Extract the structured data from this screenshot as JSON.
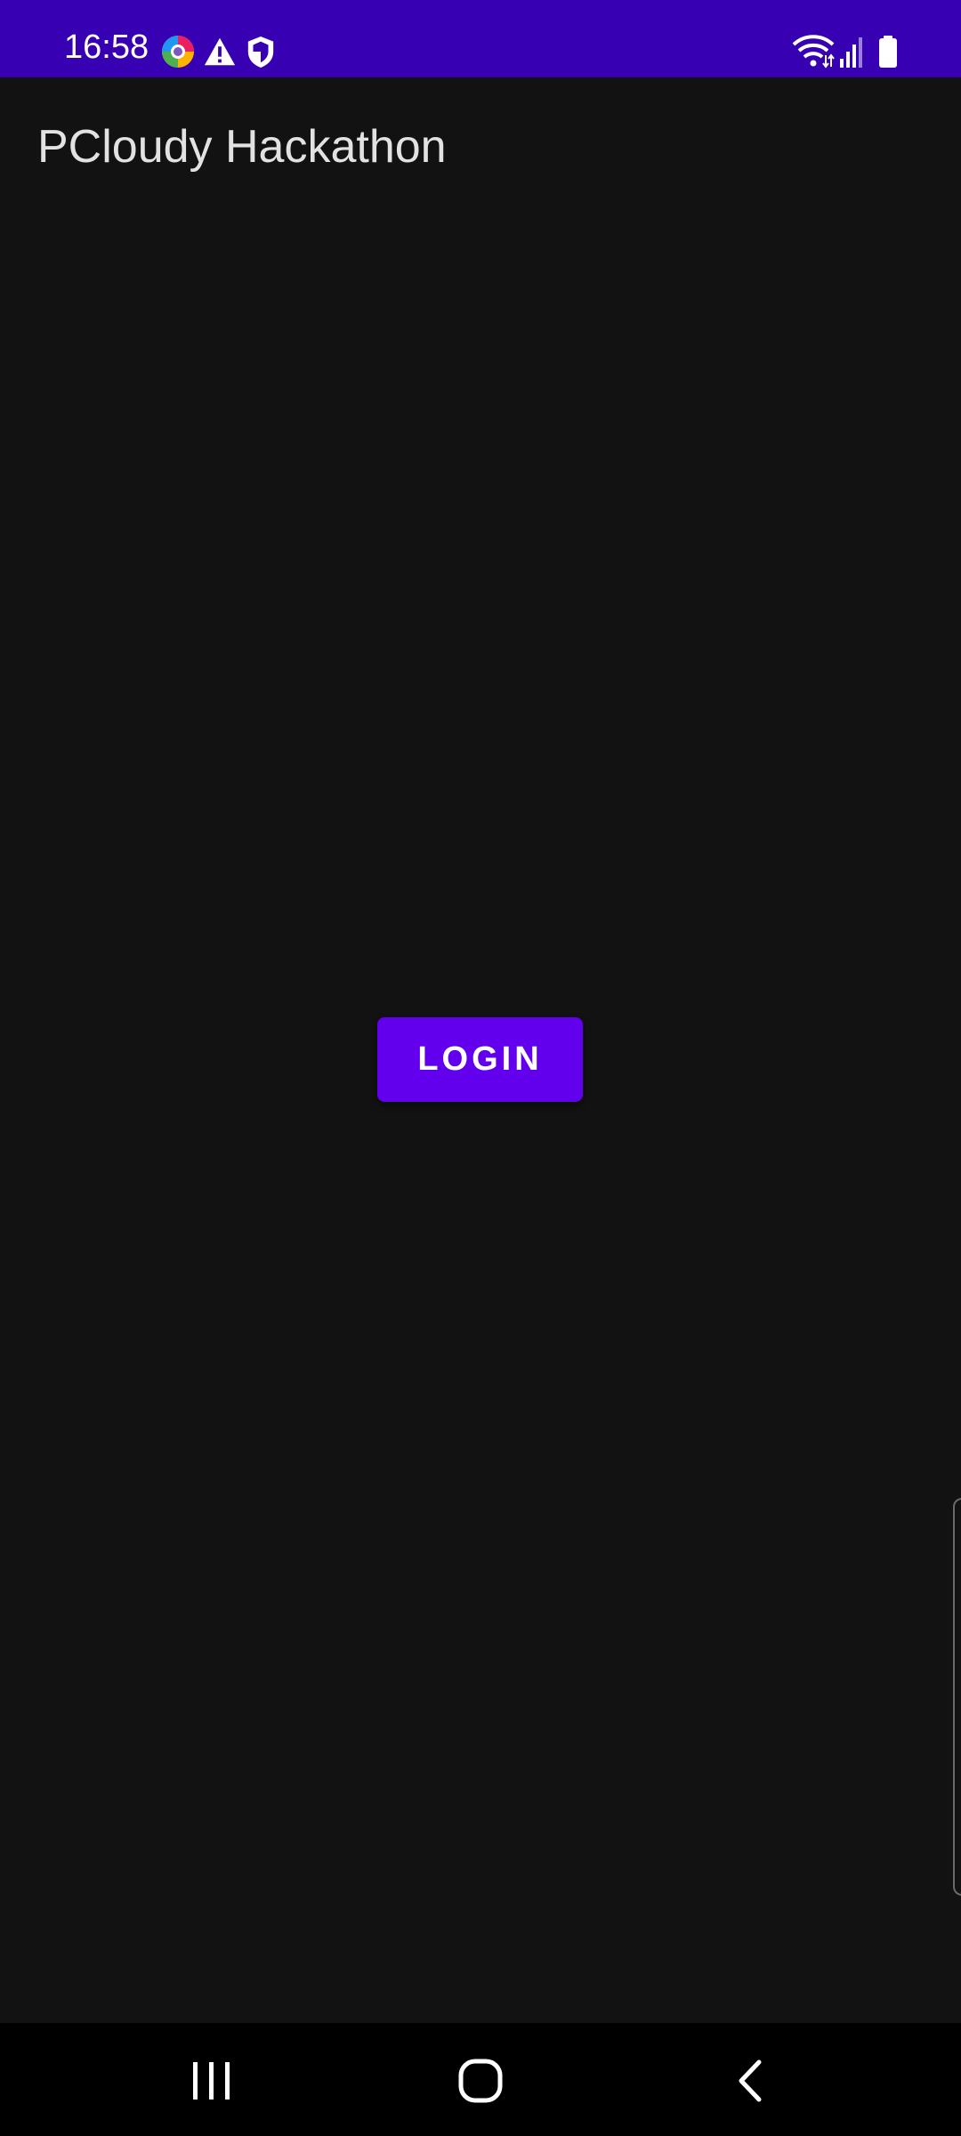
{
  "status_bar": {
    "time": "16:58",
    "background": "#3700b3",
    "notification_icons": [
      "multicolor-app-icon",
      "warning-icon",
      "shield-icon"
    ],
    "system_icons": [
      "wifi-icon",
      "signal-icon",
      "battery-icon"
    ]
  },
  "app_bar": {
    "title": "PCloudy Hackathon"
  },
  "main": {
    "login_button_label": "LOGIN",
    "button_color": "#6200ee",
    "background": "#121212"
  },
  "nav_bar": {
    "buttons": [
      "recents-icon",
      "home-icon",
      "back-icon"
    ]
  }
}
